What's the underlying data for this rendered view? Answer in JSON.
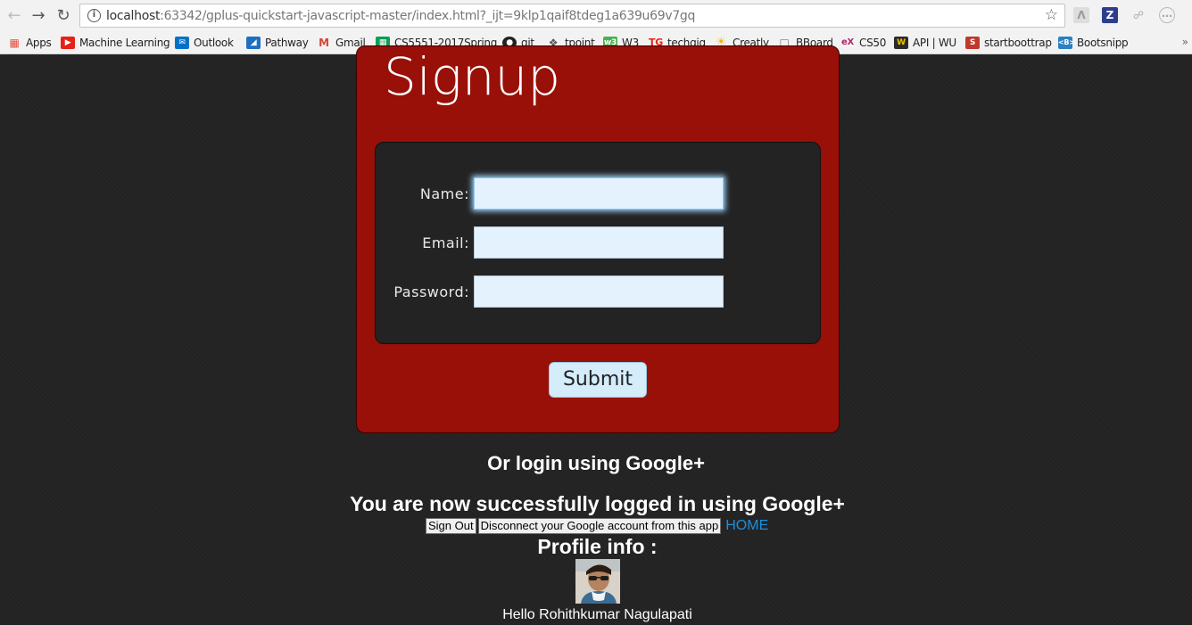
{
  "browser": {
    "url_host": "localhost",
    "url_rest": ":63342/gplus-quickstart-javascript-master/index.html?_ijt=9klp1qaif8tdeg1a639u69v7gq",
    "bookmarks": [
      {
        "label": "Apps",
        "icon": "apps-grid-icon",
        "color": "#e84c3d"
      },
      {
        "label": "Machine Learning",
        "icon": "youtube-icon",
        "color": "#e62117"
      },
      {
        "label": "Outlook",
        "icon": "outlook-mail-icon",
        "color": "#0072c6"
      },
      {
        "label": "Pathway",
        "icon": "pathway-icon",
        "color": "#1f6fbf"
      },
      {
        "label": "Gmail",
        "icon": "gmail-icon",
        "color": "#d44638"
      },
      {
        "label": "CS5551-2017Spring",
        "icon": "sheets-icon",
        "color": "#0f9d58"
      },
      {
        "label": "git",
        "icon": "github-icon",
        "color": "#222222"
      },
      {
        "label": "tpoint",
        "icon": "tpoint-icon",
        "color": "#555555"
      },
      {
        "label": "W3",
        "icon": "w3-icon",
        "color": "#4caf50"
      },
      {
        "label": "techgig",
        "icon": "techgig-icon",
        "color": "#e2231a"
      },
      {
        "label": "Creatly",
        "icon": "creately-icon",
        "color": "#f5b400"
      },
      {
        "label": "BBoard",
        "icon": "page-icon",
        "color": "#777777"
      },
      {
        "label": "CS50",
        "icon": "edx-icon",
        "color": "#b0266b"
      },
      {
        "label": "API | WU",
        "icon": "wu-icon",
        "color": "#2b2b2b"
      },
      {
        "label": "startboottrap",
        "icon": "startbootstrap-icon",
        "color": "#c0392b"
      },
      {
        "label": "Bootsnipp",
        "icon": "bootsnipp-icon",
        "color": "#2c7fc1"
      }
    ]
  },
  "signup": {
    "title": "Signup",
    "fields": {
      "name_label": "Name:",
      "email_label": "Email:",
      "password_label": "Password:",
      "name_value": "",
      "email_value": "",
      "password_value": ""
    },
    "submit_label": "Submit"
  },
  "google": {
    "or_login": "Or login using Google+",
    "success": "You are now successfully logged in using Google+",
    "sign_out_label": "Sign Out",
    "disconnect_label": "Disconnect your Google account from this app",
    "home_label": "HOME",
    "profile_heading": "Profile info :",
    "greeting": "Hello Rohithkumar Nagulapati"
  },
  "colors": {
    "panel_red": "#981008",
    "page_bg": "#232323",
    "input_bg": "#e4f2fd",
    "link_blue": "#1a8fe0"
  }
}
